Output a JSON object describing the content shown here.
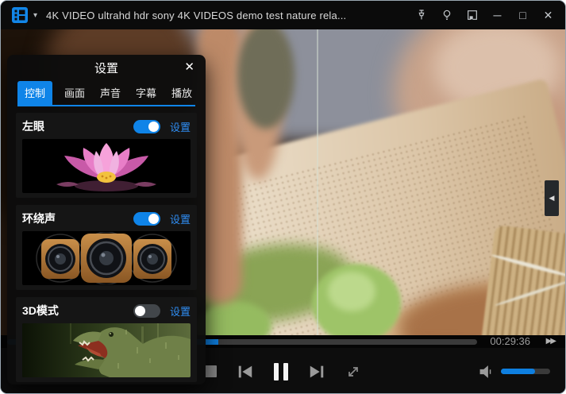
{
  "window": {
    "title": "4K VIDEO ultrahd hdr sony 4K VIDEOS demo test nature rela...",
    "app_icon": "film-strip-icon",
    "menu_caret": "▾",
    "controls": {
      "pin": "pin-icon",
      "lightbulb": "lightbulb-icon",
      "mini_player": "mini-player-icon",
      "minimize": "─",
      "maximize": "□",
      "close": "✕"
    }
  },
  "settings_panel": {
    "title": "设置",
    "close_icon": "✕",
    "tabs": [
      {
        "label": "控制",
        "active": true
      },
      {
        "label": "画面",
        "active": false
      },
      {
        "label": "声音",
        "active": false
      },
      {
        "label": "字幕",
        "active": false
      },
      {
        "label": "播放",
        "active": false
      }
    ],
    "sections": [
      {
        "label": "左眼",
        "toggle_on": true,
        "action_label": "设置",
        "image": "lotus-flower"
      },
      {
        "label": "环绕声",
        "toggle_on": true,
        "action_label": "设置",
        "image": "wooden-speakers"
      },
      {
        "label": "3D模式",
        "toggle_on": false,
        "action_label": "设置",
        "image": "dinosaur"
      }
    ]
  },
  "player": {
    "current_time": "00:29:36",
    "progress_percent": 45,
    "volume_percent": 70,
    "fast_forward_icon": "▶▶",
    "collapse_arrow": "◀",
    "transport": [
      "stop",
      "previous",
      "pause",
      "next",
      "fullscreen"
    ],
    "video_scene": "hands grating fresh wasabi on a wooden sharkskin board, bamboo bundle at right"
  },
  "colors": {
    "accent_blue": "#0f84e8",
    "link_blue": "#2f8df2",
    "progress_blue": "#0e7fe0",
    "toggle_off_gray": "#42464a"
  }
}
